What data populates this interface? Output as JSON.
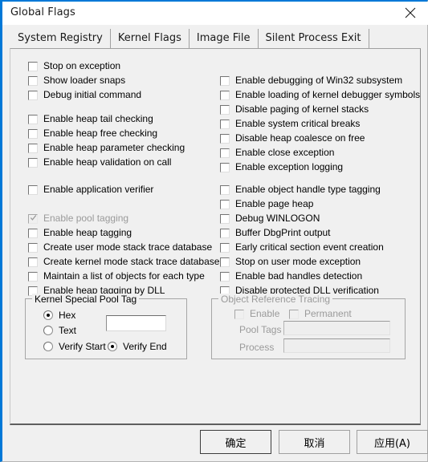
{
  "window": {
    "title": "Global Flags",
    "close_icon": "close-icon",
    "accent_color": "#0078d7",
    "background": "#f0f0f0"
  },
  "tabs": [
    {
      "label": "System Registry",
      "active": true
    },
    {
      "label": "Kernel Flags",
      "active": false
    },
    {
      "label": "Image File",
      "active": false
    },
    {
      "label": "Silent Process Exit",
      "active": false
    }
  ],
  "left_column": [
    {
      "label": "Stop on exception",
      "checked": false,
      "disabled": false
    },
    {
      "label": "Show loader snaps",
      "checked": false,
      "disabled": false
    },
    {
      "label": "Debug initial command",
      "checked": false,
      "disabled": false
    },
    {
      "label": "Enable heap tail checking",
      "checked": false,
      "disabled": false
    },
    {
      "label": "Enable heap free checking",
      "checked": false,
      "disabled": false
    },
    {
      "label": "Enable heap parameter checking",
      "checked": false,
      "disabled": false
    },
    {
      "label": "Enable heap validation on call",
      "checked": false,
      "disabled": false
    },
    {
      "label": "Enable application verifier",
      "checked": false,
      "disabled": false
    },
    {
      "label": "Enable pool tagging",
      "checked": true,
      "disabled": true
    },
    {
      "label": "Enable heap tagging",
      "checked": false,
      "disabled": false
    },
    {
      "label": "Create user mode stack trace database",
      "checked": false,
      "disabled": false
    },
    {
      "label": "Create kernel mode stack trace database",
      "checked": false,
      "disabled": false
    },
    {
      "label": "Maintain a list of objects for each type",
      "checked": false,
      "disabled": false
    },
    {
      "label": "Enable heap tagging by DLL",
      "checked": false,
      "disabled": false
    }
  ],
  "right_column": [
    {
      "label": "Enable debugging of Win32 subsystem",
      "checked": false,
      "disabled": false
    },
    {
      "label": "Enable loading of kernel debugger symbols",
      "checked": false,
      "disabled": false
    },
    {
      "label": "Disable paging of kernel stacks",
      "checked": false,
      "disabled": false
    },
    {
      "label": "Enable system critical breaks",
      "checked": false,
      "disabled": false
    },
    {
      "label": "Disable heap coalesce on free",
      "checked": false,
      "disabled": false
    },
    {
      "label": "Enable close exception",
      "checked": false,
      "disabled": false
    },
    {
      "label": "Enable exception logging",
      "checked": false,
      "disabled": false
    },
    {
      "label": "Enable object handle type tagging",
      "checked": false,
      "disabled": false
    },
    {
      "label": "Enable page heap",
      "checked": false,
      "disabled": false
    },
    {
      "label": "Debug WINLOGON",
      "checked": false,
      "disabled": false
    },
    {
      "label": "Buffer DbgPrint output",
      "checked": false,
      "disabled": false
    },
    {
      "label": "Early critical section event creation",
      "checked": false,
      "disabled": false
    },
    {
      "label": "Stop on user mode exception",
      "checked": false,
      "disabled": false
    },
    {
      "label": "Enable bad handles detection",
      "checked": false,
      "disabled": false
    },
    {
      "label": "Disable protected DLL verification",
      "checked": false,
      "disabled": false
    }
  ],
  "kernel_special_pool_tag": {
    "title": "Kernel Special Pool Tag",
    "radios": [
      {
        "label": "Hex",
        "selected": true
      },
      {
        "label": "Text",
        "selected": false
      },
      {
        "label": "Verify Start",
        "selected": false
      },
      {
        "label": "Verify End",
        "selected": true
      }
    ],
    "tag_value": "",
    "tag_placeholder": ""
  },
  "object_reference_tracing": {
    "title": "Object Reference Tracing",
    "enable_label": "Enable",
    "enable_checked": false,
    "permanent_label": "Permanent",
    "permanent_checked": false,
    "pool_tags_label": "Pool Tags",
    "pool_tags_value": "",
    "process_label": "Process",
    "process_value": ""
  },
  "buttons": {
    "ok": "确定",
    "cancel": "取消",
    "apply": "应用(A)"
  }
}
